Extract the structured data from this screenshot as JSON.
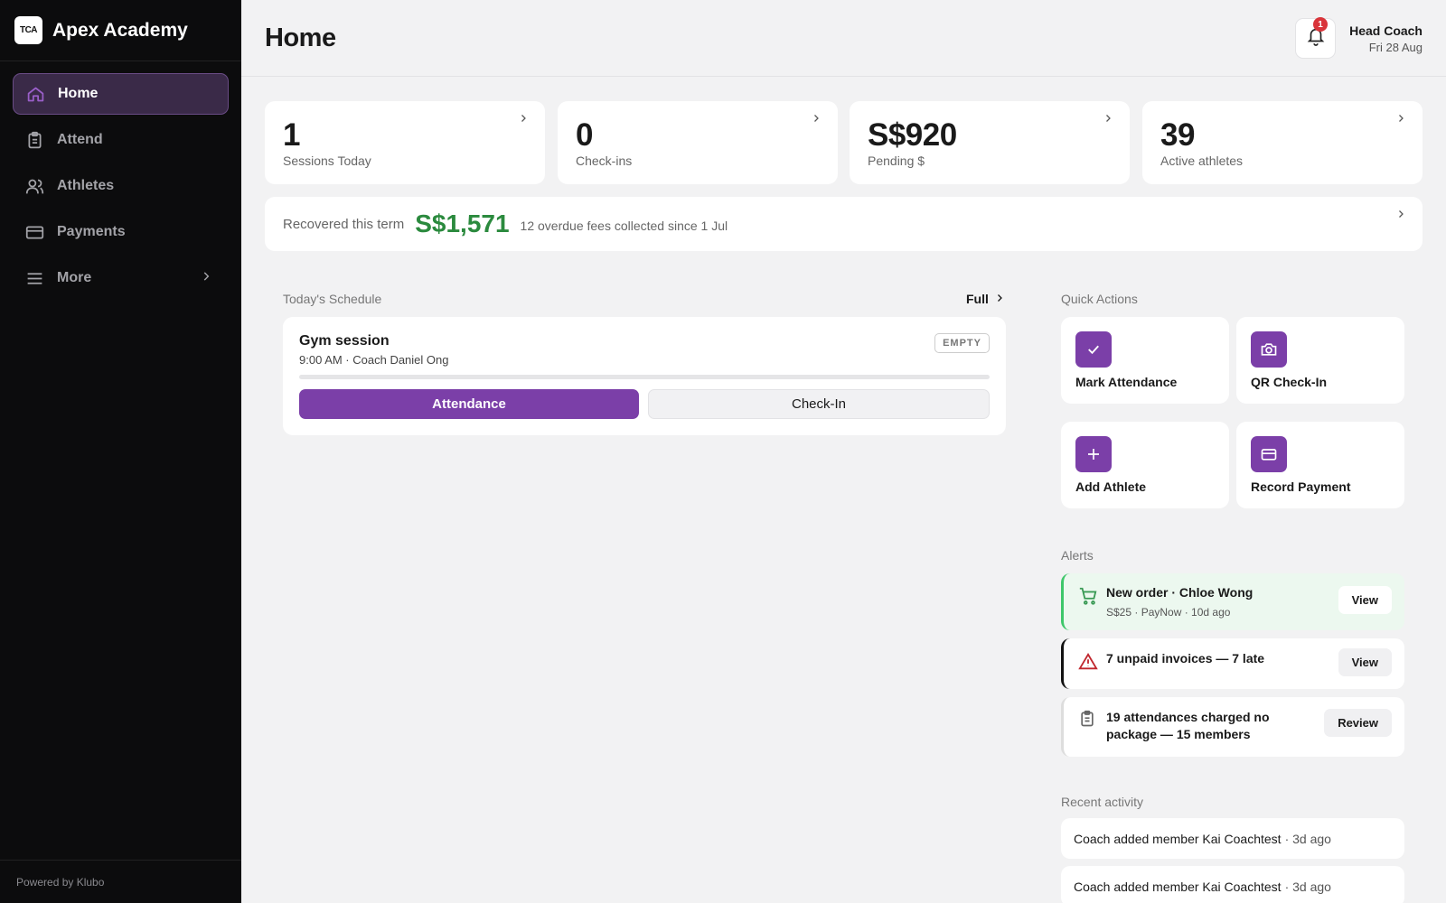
{
  "brand": {
    "logo_text": "TCA",
    "name": "Apex Academy"
  },
  "sidebar": {
    "items": [
      {
        "label": "Home",
        "icon": "home-icon",
        "active": true
      },
      {
        "label": "Attend",
        "icon": "clipboard-icon"
      },
      {
        "label": "Athletes",
        "icon": "users-icon"
      },
      {
        "label": "Payments",
        "icon": "credit-card-icon"
      },
      {
        "label": "More",
        "icon": "menu-icon"
      }
    ],
    "powered_by": "Powered by Klubo"
  },
  "header": {
    "title": "Home",
    "notification_count": "1",
    "user_name": "Head Coach",
    "date": "Fri 28 Aug"
  },
  "stats": [
    {
      "value": "1",
      "label": "Sessions Today"
    },
    {
      "value": "0",
      "label": "Check-ins"
    },
    {
      "value": "S$920",
      "label": "Pending $"
    },
    {
      "value": "39",
      "label": "Active athletes"
    }
  ],
  "recovered": {
    "label": "Recovered this term",
    "amount": "S$1,571",
    "description": "12 overdue fees collected since 1 Jul"
  },
  "schedule": {
    "section_label": "Today's Schedule",
    "full_link": "Full",
    "session": {
      "title": "Gym session",
      "subtitle": "9:00 AM · Coach Daniel Ong",
      "status": "EMPTY",
      "progress": 0,
      "attendance_button": "Attendance",
      "checkin_button": "Check-In"
    }
  },
  "quick_actions": {
    "section_label": "Quick Actions",
    "items": [
      {
        "label": "Mark Attendance",
        "icon": "check-icon"
      },
      {
        "label": "QR Check-In",
        "icon": "camera-icon"
      },
      {
        "label": "Add Athlete",
        "icon": "plus-icon"
      },
      {
        "label": "Record Payment",
        "icon": "credit-card-icon"
      }
    ]
  },
  "alerts": {
    "section_label": "Alerts",
    "items": [
      {
        "title": "New order · Chloe Wong",
        "subtitle": "S$25 · PayNow · 10d ago",
        "button": "View",
        "icon": "cart-icon",
        "accent": "#3ec76a"
      },
      {
        "title": "7 unpaid invoices — 7 late",
        "button": "View",
        "icon": "warning-icon",
        "accent": "#c0262d"
      },
      {
        "title": "19 attendances charged no package — 15 members",
        "button": "Review",
        "icon": "clipboard-icon"
      }
    ]
  },
  "activity": {
    "section_label": "Recent activity",
    "items": [
      {
        "text": "Coach added member Kai Coachtest",
        "ago": "· 3d ago"
      },
      {
        "text": "Coach added member Kai Coachtest",
        "ago": "· 3d ago"
      }
    ]
  },
  "colors": {
    "accent": "#7b3fa8",
    "success": "#2b8a3e",
    "danger": "#d9343a",
    "sidebar_bg": "#0c0c0d"
  }
}
